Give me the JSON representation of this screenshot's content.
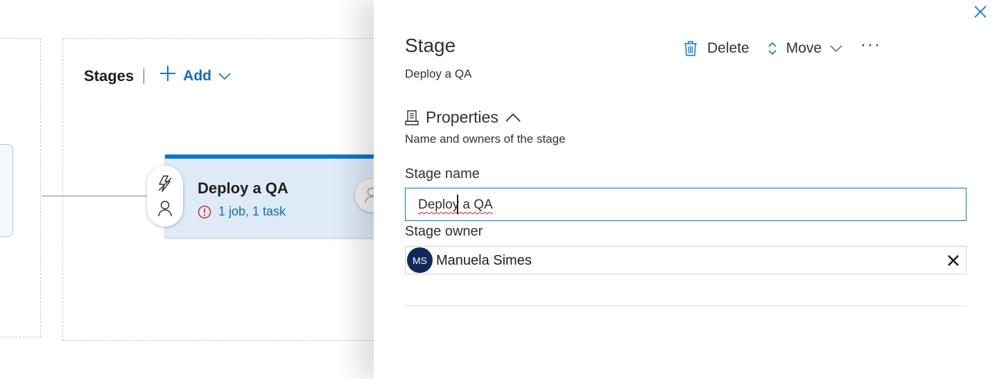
{
  "canvas": {
    "stages_title": "Stages",
    "add_label": "Add",
    "stage_card": {
      "title": "Deploy a QA",
      "status": "1 job, 1 task"
    }
  },
  "panel": {
    "title": "Stage",
    "subtitle": "Deploy a QA",
    "toolbar": {
      "delete_label": "Delete",
      "move_label": "Move",
      "more_label": "···"
    },
    "properties": {
      "label": "Properties",
      "description": "Name and owners of the stage"
    },
    "stage_name": {
      "label": "Stage name",
      "value": "Deploy a QA"
    },
    "stage_owner": {
      "label": "Stage owner",
      "initials": "MS",
      "name": "Manuela Simes"
    }
  },
  "colors": {
    "accent": "#0078d4",
    "link": "#106ebe",
    "card_bg": "#deeaf6",
    "error": "#d13438",
    "avatar_bg": "#0f2a5a"
  },
  "icons": [
    "plus-icon",
    "chevron-down-icon",
    "lightning-icon",
    "person-icon",
    "error-icon",
    "close-icon",
    "trash-icon",
    "move-updown-icon",
    "more-icon",
    "properties-icon",
    "chevron-up-icon",
    "clear-icon"
  ]
}
